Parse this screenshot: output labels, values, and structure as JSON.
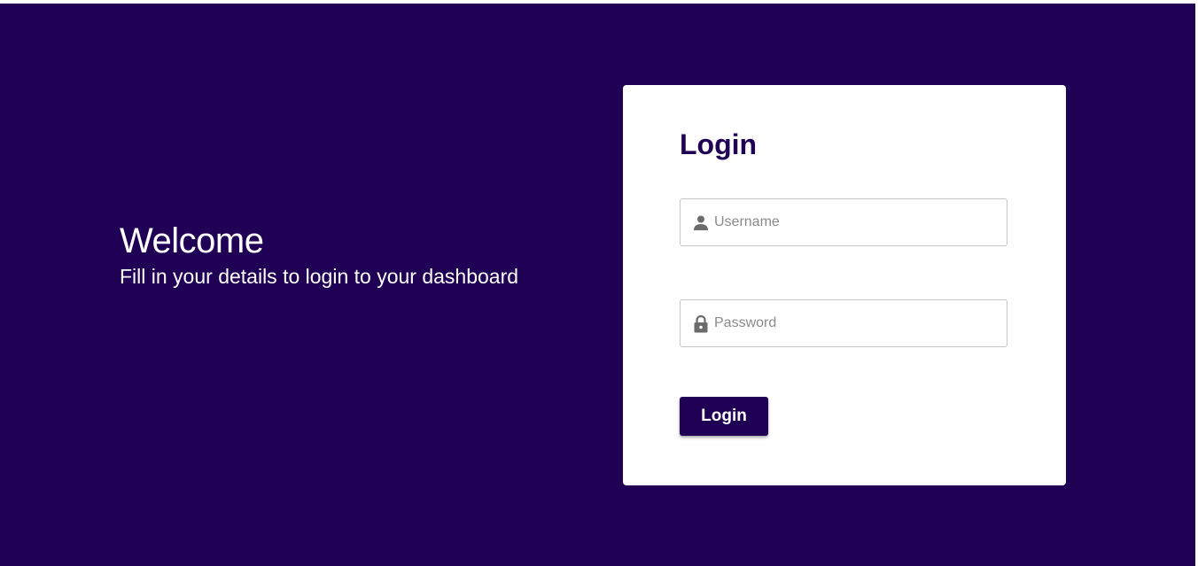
{
  "welcome": {
    "title": "Welcome",
    "subtitle": "Fill in your details to login to your dashboard"
  },
  "login_card": {
    "title": "Login",
    "username": {
      "placeholder": "Username",
      "value": "",
      "icon": "user-icon"
    },
    "password": {
      "placeholder": "Password",
      "value": "",
      "icon": "lock-icon"
    },
    "submit_label": "Login"
  },
  "colors": {
    "brand": "#200055",
    "card_background": "#ffffff",
    "placeholder": "#8a8a8a",
    "icon": "#6b6b6b"
  }
}
